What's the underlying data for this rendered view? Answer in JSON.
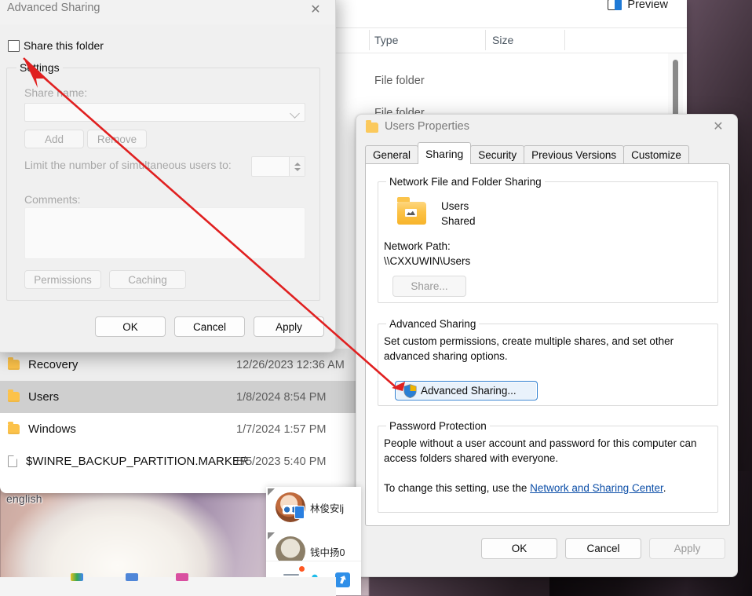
{
  "desktop": {
    "label": "english"
  },
  "explorer": {
    "toolbar": {
      "preview_label": "Preview",
      "preview_icon": "preview-pane-icon"
    },
    "columns": [
      "Type",
      "Size"
    ],
    "rows": [
      {
        "name": "Recovery",
        "date": "12/26/2023 12:36 AM",
        "type": "",
        "icon": "folder-icon",
        "state": "hover"
      },
      {
        "name": "Users",
        "date": "1/8/2024 8:54 PM",
        "type": "",
        "icon": "folder-icon",
        "state": "selected"
      },
      {
        "name": "Windows",
        "date": "1/7/2024 1:57 PM",
        "type": "",
        "icon": "folder-icon",
        "state": "normal"
      },
      {
        "name": "$WINRE_BACKUP_PARTITION.MARKER",
        "date": "8/5/2023 5:40 PM",
        "type": "",
        "icon": "file-icon",
        "state": "normal"
      }
    ],
    "type_cells": [
      "File folder",
      "File folder"
    ]
  },
  "properties_dialog": {
    "title": "Users Properties",
    "title_icon": "folder-icon",
    "close_label": "✕",
    "tabs": [
      {
        "label": "General",
        "active": false
      },
      {
        "label": "Sharing",
        "active": true
      },
      {
        "label": "Security",
        "active": false
      },
      {
        "label": "Previous Versions",
        "active": false
      },
      {
        "label": "Customize",
        "active": false
      }
    ],
    "network_sharing": {
      "legend": "Network File and Folder Sharing",
      "folder_icon": "shared-folder-icon",
      "folder_name": "Users",
      "folder_status": "Shared",
      "path_label": "Network Path:",
      "path_value": "\\\\CXXUWIN\\Users",
      "share_button": "Share..."
    },
    "advanced_sharing": {
      "legend": "Advanced Sharing",
      "description_line1": "Set custom permissions, create multiple shares, and set other",
      "description_line2": "advanced sharing options.",
      "button_label": "Advanced Sharing...",
      "button_icon": "uac-shield-icon"
    },
    "password_protection": {
      "legend": "Password Protection",
      "line1": "People without a user account and password for this computer can",
      "line2": "access folders shared with everyone.",
      "line3_prefix": "To change this setting, use the ",
      "link_text": "Network and Sharing Center",
      "line3_suffix": "."
    },
    "footer": {
      "ok": "OK",
      "cancel": "Cancel",
      "apply": "Apply",
      "apply_disabled": true
    }
  },
  "advanced_sharing_dialog": {
    "title": "Advanced Sharing",
    "close_label": "✕",
    "share_checkbox": {
      "label": "Share this folder",
      "checked": false
    },
    "settings": {
      "legend": "Settings",
      "share_name_label": "Share name:",
      "share_name_value": "",
      "add_button": "Add",
      "remove_button": "Remove",
      "limit_label": "Limit the number of simultaneous users to:",
      "limit_value": "",
      "comments_label": "Comments:",
      "comments_value": "",
      "permissions_button": "Permissions",
      "caching_button": "Caching"
    },
    "footer": {
      "ok": "OK",
      "cancel": "Cancel",
      "apply": "Apply"
    }
  },
  "chat_popup": {
    "contacts": [
      {
        "name": "林俊安lj",
        "avatar": "avatar-anime-icon",
        "badge": "mobile-device-icon"
      },
      {
        "name": "钱中扬0",
        "avatar": "avatar-photo-icon",
        "badge": ""
      }
    ],
    "toolbar": {
      "menu_icon": "hamburger-menu-icon",
      "add_friend_icon": "add-contact-icon",
      "share_icon": "blue-share-icon",
      "notification_dot": true
    }
  },
  "annotation": {
    "color": "#e02020",
    "type": "arrow",
    "from": "Advanced Sharing... button",
    "to": "Share this folder checkbox"
  }
}
